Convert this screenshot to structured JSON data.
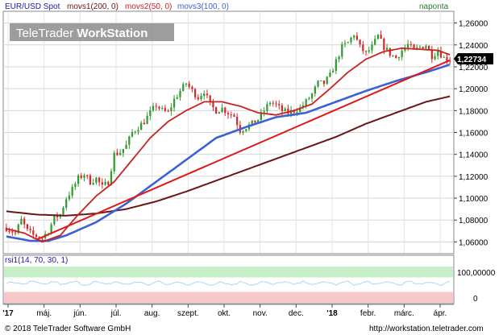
{
  "header": {
    "legend_instrument": "EUR/USD Spot",
    "legend_mas": [
      "movs1(200, 0)",
      "movs2(50, 0)",
      "movs3(100, 0)"
    ],
    "period": "naponta"
  },
  "logo": {
    "text_light": "TeleTrader ",
    "text_bold": "WorkStation"
  },
  "footer": {
    "copyright": "© 2018 TeleTrader Software GmbH",
    "url": "http://workstation.teletrader.com"
  },
  "colors": {
    "up": "#2f9a2f",
    "down": "#d8262b",
    "ma200": "#6b1515",
    "ma50": "#cc2020",
    "ma100": "#3b62d4",
    "trend": "#e01818",
    "rsi": "#a8d8ec",
    "rsi_upper_band": "#c8f0c8",
    "rsi_lower_band": "#f8c8c8",
    "last_price_box": "#000000"
  },
  "chart_data": [
    {
      "type": "candlestick",
      "ylim": [
        1.05,
        1.27
      ],
      "y_ticks": [
        "1,26000",
        "1,24000",
        "1,22000",
        "1,20000",
        "1,18000",
        "1,16000",
        "1,14000",
        "1,12000",
        "1,10000",
        "1,08000",
        "1,06000"
      ],
      "x_ticks": [
        "'17",
        "máj.",
        "jún.",
        "júl.",
        "aug.",
        "szept.",
        "okt.",
        "nov.",
        "dec.",
        "'18",
        "febr.",
        "márc.",
        "ápr."
      ],
      "last_price": "1,22734",
      "close_anchors": [
        [
          0,
          1.073
        ],
        [
          3,
          1.068
        ],
        [
          5,
          1.08
        ],
        [
          7,
          1.07
        ],
        [
          9,
          1.066
        ],
        [
          12,
          1.064
        ],
        [
          14,
          1.07
        ],
        [
          16,
          1.082
        ],
        [
          18,
          1.085
        ],
        [
          20,
          1.1
        ],
        [
          22,
          1.108
        ],
        [
          24,
          1.118
        ],
        [
          26,
          1.122
        ],
        [
          28,
          1.115
        ],
        [
          30,
          1.118
        ],
        [
          32,
          1.11
        ],
        [
          34,
          1.115
        ],
        [
          36,
          1.14
        ],
        [
          38,
          1.142
        ],
        [
          40,
          1.148
        ],
        [
          42,
          1.16
        ],
        [
          44,
          1.165
        ],
        [
          46,
          1.17
        ],
        [
          48,
          1.178
        ],
        [
          50,
          1.185
        ],
        [
          52,
          1.18
        ],
        [
          54,
          1.178
        ],
        [
          56,
          1.19
        ],
        [
          58,
          1.198
        ],
        [
          60,
          1.205
        ],
        [
          62,
          1.198
        ],
        [
          64,
          1.192
        ],
        [
          66,
          1.198
        ],
        [
          68,
          1.185
        ],
        [
          70,
          1.18
        ],
        [
          72,
          1.182
        ],
        [
          74,
          1.178
        ],
        [
          76,
          1.175
        ],
        [
          78,
          1.162
        ],
        [
          80,
          1.165
        ],
        [
          82,
          1.168
        ],
        [
          84,
          1.172
        ],
        [
          86,
          1.18
        ],
        [
          88,
          1.188
        ],
        [
          90,
          1.185
        ],
        [
          92,
          1.18
        ],
        [
          94,
          1.178
        ],
        [
          96,
          1.18
        ],
        [
          98,
          1.182
        ],
        [
          100,
          1.188
        ],
        [
          102,
          1.195
        ],
        [
          104,
          1.205
        ],
        [
          106,
          1.205
        ],
        [
          108,
          1.212
        ],
        [
          110,
          1.225
        ],
        [
          112,
          1.238
        ],
        [
          114,
          1.242
        ],
        [
          116,
          1.25
        ],
        [
          118,
          1.238
        ],
        [
          120,
          1.232
        ],
        [
          122,
          1.238
        ],
        [
          124,
          1.248
        ],
        [
          126,
          1.238
        ],
        [
          128,
          1.232
        ],
        [
          130,
          1.228
        ],
        [
          132,
          1.235
        ],
        [
          134,
          1.24
        ],
        [
          136,
          1.235
        ],
        [
          138,
          1.238
        ],
        [
          140,
          1.24
        ],
        [
          142,
          1.23
        ],
        [
          144,
          1.235
        ],
        [
          146,
          1.228
        ],
        [
          148,
          1.227
        ]
      ],
      "ma200_points": [
        [
          0,
          1.088
        ],
        [
          10,
          1.085
        ],
        [
          20,
          1.084
        ],
        [
          30,
          1.086
        ],
        [
          40,
          1.09
        ],
        [
          50,
          1.097
        ],
        [
          60,
          1.106
        ],
        [
          70,
          1.116
        ],
        [
          80,
          1.126
        ],
        [
          90,
          1.136
        ],
        [
          100,
          1.146
        ],
        [
          110,
          1.156
        ],
        [
          120,
          1.168
        ],
        [
          130,
          1.178
        ],
        [
          140,
          1.188
        ],
        [
          148,
          1.193
        ]
      ],
      "ma100_points": [
        [
          0,
          1.065
        ],
        [
          8,
          1.061
        ],
        [
          14,
          1.061
        ],
        [
          20,
          1.066
        ],
        [
          30,
          1.078
        ],
        [
          40,
          1.095
        ],
        [
          50,
          1.115
        ],
        [
          60,
          1.135
        ],
        [
          70,
          1.155
        ],
        [
          80,
          1.165
        ],
        [
          90,
          1.174
        ],
        [
          100,
          1.178
        ],
        [
          110,
          1.188
        ],
        [
          120,
          1.198
        ],
        [
          130,
          1.207
        ],
        [
          140,
          1.215
        ],
        [
          148,
          1.222
        ]
      ],
      "ma50_points": [
        [
          0,
          1.072
        ],
        [
          6,
          1.068
        ],
        [
          12,
          1.06
        ],
        [
          18,
          1.066
        ],
        [
          24,
          1.085
        ],
        [
          30,
          1.102
        ],
        [
          36,
          1.115
        ],
        [
          42,
          1.135
        ],
        [
          48,
          1.155
        ],
        [
          54,
          1.17
        ],
        [
          60,
          1.18
        ],
        [
          66,
          1.188
        ],
        [
          72,
          1.188
        ],
        [
          78,
          1.184
        ],
        [
          84,
          1.178
        ],
        [
          90,
          1.176
        ],
        [
          96,
          1.18
        ],
        [
          102,
          1.186
        ],
        [
          108,
          1.2
        ],
        [
          114,
          1.215
        ],
        [
          120,
          1.227
        ],
        [
          126,
          1.234
        ],
        [
          132,
          1.237
        ],
        [
          138,
          1.236
        ],
        [
          144,
          1.235
        ],
        [
          148,
          1.231
        ]
      ],
      "trendline": [
        [
          10,
          1.062
        ],
        [
          148,
          1.226
        ]
      ]
    },
    {
      "type": "line",
      "title": "rsi1(14, 70, 30, 1)",
      "ylim": [
        0,
        100
      ],
      "y_ticks": [
        "100,00000",
        "0"
      ],
      "rsi_bands": [
        30,
        70
      ],
      "rsi_mean": 54
    }
  ]
}
